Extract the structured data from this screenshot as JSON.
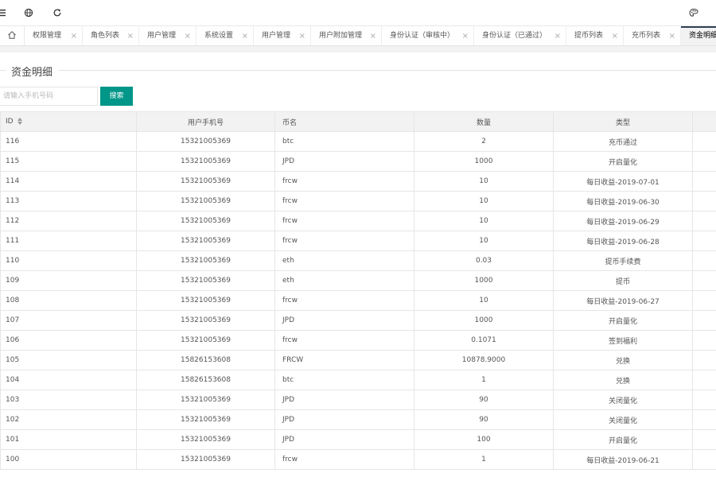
{
  "tabs": [
    {
      "label": "权限管理",
      "close": "×",
      "w": 73
    },
    {
      "label": "角色列表",
      "close": "×",
      "w": 71
    },
    {
      "label": "用户管理",
      "close": "×",
      "w": 72
    },
    {
      "label": "系统设置",
      "close": "×",
      "w": 72
    },
    {
      "label": "用户管理",
      "close": "×",
      "w": 72
    },
    {
      "label": "用户附加管理",
      "close": "×",
      "w": 89
    },
    {
      "label": "身份认证（审核中）",
      "close": "×",
      "w": 116
    },
    {
      "label": "身份认证（已通过）",
      "close": "×",
      "w": 116
    },
    {
      "label": "提币列表",
      "close": "×",
      "w": 72
    },
    {
      "label": "充币列表",
      "close": "×",
      "w": 72
    },
    {
      "label": "资金明细",
      "close": "×",
      "w": 72
    }
  ],
  "page": {
    "title": "资金明细"
  },
  "search": {
    "placeholder": "请输入手机号码",
    "button": "搜索"
  },
  "table": {
    "headers": {
      "id": "ID",
      "phone": "用户手机号",
      "coin": "币名",
      "qty": "数量",
      "type": "类型"
    },
    "rows": [
      {
        "id": "116",
        "phone": "15321005369",
        "coin": "btc",
        "qty": "2",
        "type": "充币通过"
      },
      {
        "id": "115",
        "phone": "15321005369",
        "coin": "JPD",
        "qty": "1000",
        "type": "开启量化"
      },
      {
        "id": "114",
        "phone": "15321005369",
        "coin": "frcw",
        "qty": "10",
        "type": "每日收益-2019-07-01"
      },
      {
        "id": "113",
        "phone": "15321005369",
        "coin": "frcw",
        "qty": "10",
        "type": "每日收益-2019-06-30"
      },
      {
        "id": "112",
        "phone": "15321005369",
        "coin": "frcw",
        "qty": "10",
        "type": "每日收益-2019-06-29"
      },
      {
        "id": "111",
        "phone": "15321005369",
        "coin": "frcw",
        "qty": "10",
        "type": "每日收益-2019-06-28"
      },
      {
        "id": "110",
        "phone": "15321005369",
        "coin": "eth",
        "qty": "0.03",
        "type": "提币手续费"
      },
      {
        "id": "109",
        "phone": "15321005369",
        "coin": "eth",
        "qty": "1000",
        "type": "提币"
      },
      {
        "id": "108",
        "phone": "15321005369",
        "coin": "frcw",
        "qty": "10",
        "type": "每日收益-2019-06-27"
      },
      {
        "id": "107",
        "phone": "15321005369",
        "coin": "JPD",
        "qty": "1000",
        "type": "开启量化"
      },
      {
        "id": "106",
        "phone": "15321005369",
        "coin": "frcw",
        "qty": "0.1071",
        "type": "签到福利"
      },
      {
        "id": "105",
        "phone": "15826153608",
        "coin": "FRCW",
        "qty": "10878.9000",
        "type": "兑换"
      },
      {
        "id": "104",
        "phone": "15826153608",
        "coin": "btc",
        "qty": "1",
        "type": "兑换"
      },
      {
        "id": "103",
        "phone": "15321005369",
        "coin": "JPD",
        "qty": "90",
        "type": "关闭量化"
      },
      {
        "id": "102",
        "phone": "15321005369",
        "coin": "JPD",
        "qty": "90",
        "type": "关闭量化"
      },
      {
        "id": "101",
        "phone": "15321005369",
        "coin": "JPD",
        "qty": "100",
        "type": "开启量化"
      },
      {
        "id": "100",
        "phone": "15321005369",
        "coin": "frcw",
        "qty": "1",
        "type": "每日收益-2019-06-21"
      }
    ]
  }
}
